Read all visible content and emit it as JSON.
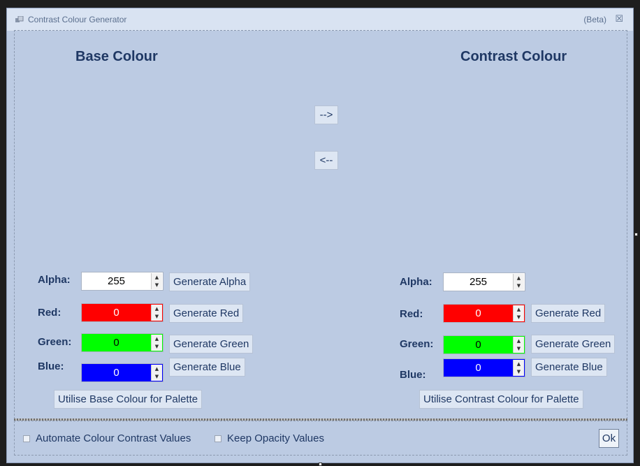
{
  "window": {
    "title": "Contrast Colour Generator",
    "beta": "(Beta)",
    "close": "☒"
  },
  "base": {
    "heading": "Base Colour",
    "alpha": {
      "label": "Alpha:",
      "value": "255",
      "button": "Generate Alpha",
      "bg": "#ffffff",
      "fg": "#000000"
    },
    "red": {
      "label": "Red:",
      "value": "0",
      "button": "Generate Red",
      "bg": "#ff0000",
      "fg": "#ffffff"
    },
    "green": {
      "label": "Green:",
      "value": "0",
      "button": "Generate Green",
      "bg": "#00ff00",
      "fg": "#000000"
    },
    "blue": {
      "label": "Blue:",
      "value": "0",
      "button": "Generate Blue",
      "bg": "#0000ff",
      "fg": "#ffffff"
    },
    "palette_button": "Utilise Base Colour for Palette"
  },
  "contrast": {
    "heading": "Contrast Colour",
    "alpha": {
      "label": "Alpha:",
      "value": "255",
      "bg": "#ffffff",
      "fg": "#000000"
    },
    "red": {
      "label": "Red:",
      "value": "0",
      "button": "Generate Red",
      "bg": "#ff0000",
      "fg": "#ffffff"
    },
    "green": {
      "label": "Green:",
      "value": "0",
      "button": "Generate Green",
      "bg": "#00ff00",
      "fg": "#000000"
    },
    "blue": {
      "label": "Blue:",
      "value": "0",
      "button": "Generate Blue",
      "bg": "#0000ff",
      "fg": "#ffffff"
    },
    "palette_button": "Utilise Contrast Colour for Palette"
  },
  "transfer": {
    "forward": "-->",
    "back": "<--"
  },
  "options": {
    "automate": {
      "label": "Automate Colour Contrast Values",
      "checked": false
    },
    "keep_opacity": {
      "label": "Keep Opacity Values",
      "checked": false
    }
  },
  "ok_button": "Ok",
  "spin_icons": {
    "up": "▲",
    "down": "▼"
  }
}
